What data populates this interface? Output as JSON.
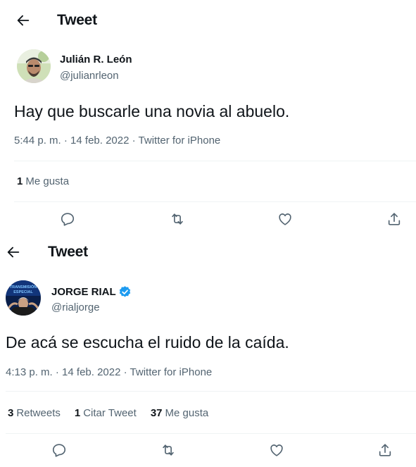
{
  "tweets": [
    {
      "header_title": "Tweet",
      "author_name": "Julián R. León",
      "author_handle": "@julianrleon",
      "verified": false,
      "text": "Hay que buscarle una novia al abuelo.",
      "time": "5:44 p. m.",
      "date": "14 feb. 2022",
      "source": "Twitter for iPhone",
      "separator": "·",
      "stats": [
        {
          "num": "1",
          "label": "Me gusta"
        }
      ]
    },
    {
      "header_title": "Tweet",
      "author_name": "JORGE RIAL",
      "author_handle": "@rialjorge",
      "verified": true,
      "avatar_text": "TRANSMISIÓN ESPECIAL",
      "text": "De acá se escucha el ruido de la caída.",
      "time": "4:13 p. m.",
      "date": "14 feb. 2022",
      "source": "Twitter for iPhone",
      "separator": "·",
      "stats": [
        {
          "num": "3",
          "label": "Retweets"
        },
        {
          "num": "1",
          "label": "Citar Tweet"
        },
        {
          "num": "37",
          "label": "Me gusta"
        }
      ]
    }
  ],
  "icons": {
    "back": "arrow-left-icon",
    "reply": "reply-icon",
    "retweet": "retweet-icon",
    "like": "heart-icon",
    "share": "share-icon",
    "verified": "verified-badge-icon"
  },
  "colors": {
    "text": "#0f1419",
    "secondary": "#536471",
    "verified": "#1d9bf0",
    "divider": "#eff3f4"
  }
}
